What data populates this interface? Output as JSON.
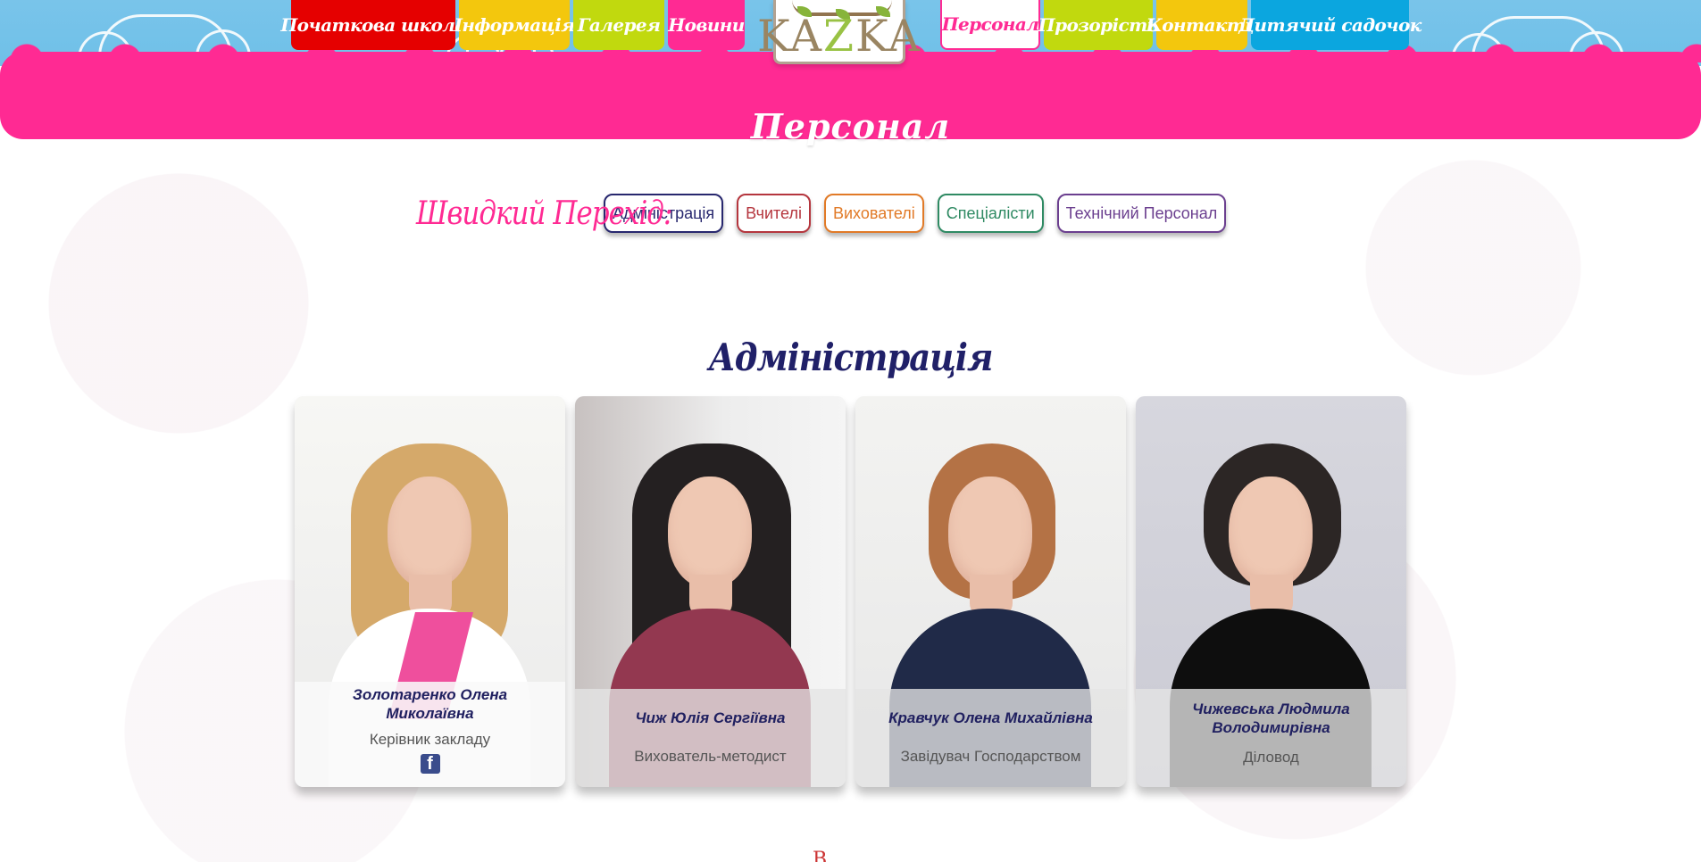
{
  "navigation": {
    "left": [
      {
        "label": "Початкова школа",
        "color": "#e50000"
      },
      {
        "label": "Інформація",
        "color": "#f3c70d"
      },
      {
        "label": "Галерея",
        "color": "#c1d90e"
      },
      {
        "label": "Новини",
        "color": "#ff2a93"
      }
    ],
    "right": [
      {
        "label": "Персонал",
        "color": "#ff2a93",
        "active": true
      },
      {
        "label": "Прозорість",
        "color": "#c1d90e"
      },
      {
        "label": "Контакти",
        "color": "#f3c70d"
      },
      {
        "label": "Дитячий садочок",
        "color": "#0ba6df"
      }
    ]
  },
  "logo": {
    "text_before": "KA",
    "text_highlight": "Z",
    "text_after": "KA"
  },
  "page": {
    "title": "Персонал"
  },
  "quick_navigation": {
    "label": "Швидкий Перехід:",
    "links": [
      {
        "label": "Адміністрація",
        "color": "#27276e"
      },
      {
        "label": "Вчителі",
        "color": "#b5363e"
      },
      {
        "label": "Вихователі",
        "color": "#e17a27"
      },
      {
        "label": "Спеціалісти",
        "color": "#2f8a63"
      },
      {
        "label": "Технічний Персонал",
        "color": "#6b3f8f"
      }
    ]
  },
  "section": {
    "title": "Адміністрація"
  },
  "staff": [
    {
      "name": "Золотаренко Олена Миколаївна",
      "role": "Керівник закладу",
      "social": "f"
    },
    {
      "name": "Чиж Юлія Сергіївна",
      "role": "Вихователь-методист"
    },
    {
      "name": "Кравчук Олена Михайлівна",
      "role": "Завідувач Господарством"
    },
    {
      "name": "Чижевська Людмила Володимирівна",
      "role": "Діловод"
    }
  ],
  "partial_content": {
    "next_section_fragment": "В"
  },
  "icons": {
    "facebook": "facebook-icon",
    "logo_leaf": "leaf-icon"
  }
}
